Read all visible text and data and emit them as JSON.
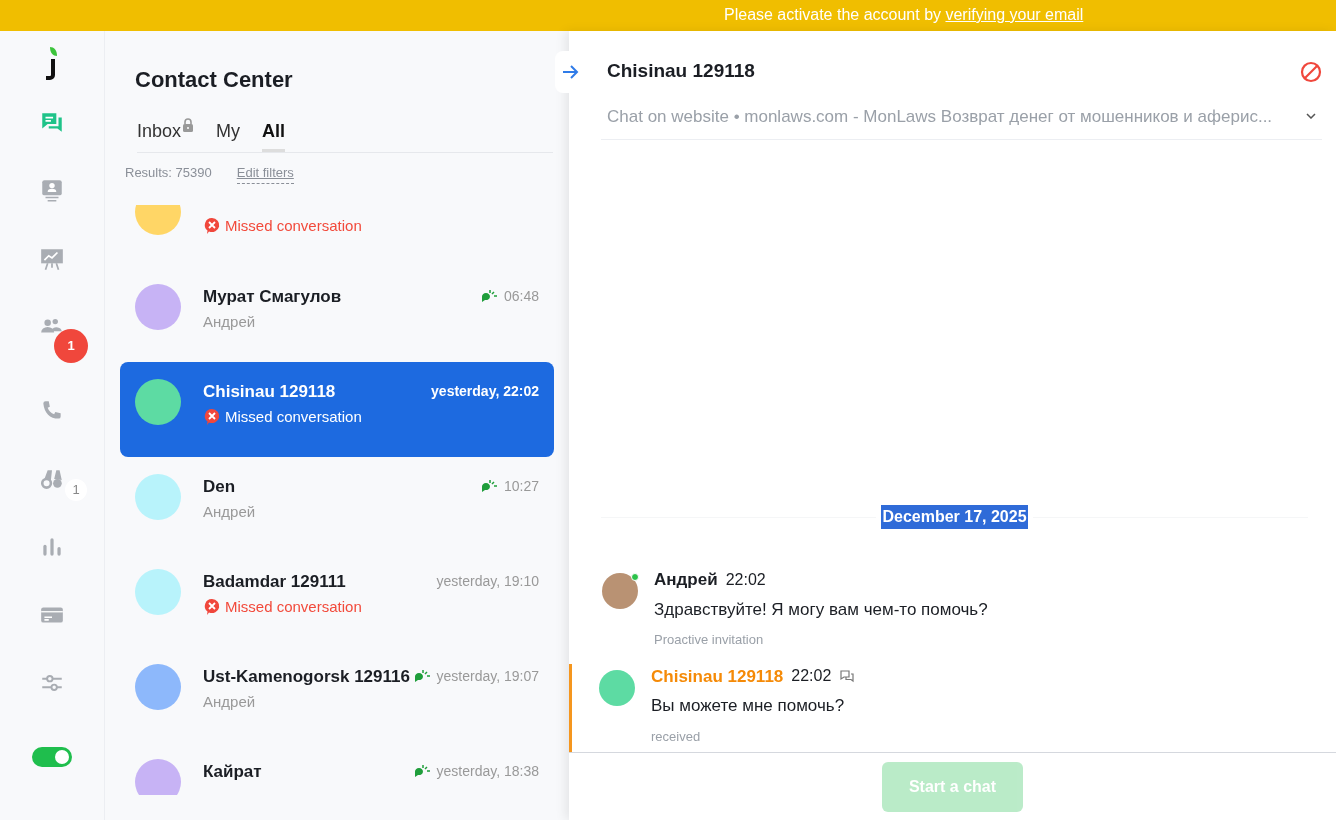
{
  "banner": {
    "text": "Please activate the account by ",
    "link": "verifying your email"
  },
  "sidebar": {
    "items": [
      {
        "kind": "chats",
        "selected": true
      },
      {
        "kind": "contacts",
        "selected": false
      },
      {
        "kind": "reports",
        "selected": false
      },
      {
        "kind": "team",
        "selected": false,
        "badge": "1",
        "badge_alert": true
      },
      {
        "kind": "phone",
        "selected": false
      },
      {
        "kind": "binoculars",
        "selected": false,
        "badge": "1",
        "badge_alert": false
      },
      {
        "kind": "stats",
        "selected": false
      },
      {
        "kind": "billing",
        "selected": false
      },
      {
        "kind": "settings",
        "selected": false
      }
    ],
    "status_toggle": {
      "on": true
    }
  },
  "list": {
    "title": "Contact Center",
    "tabs": [
      {
        "label": "Inbox",
        "locked": true,
        "selected": false
      },
      {
        "label": "My",
        "locked": false,
        "selected": false
      },
      {
        "label": "All",
        "locked": false,
        "selected": true
      }
    ],
    "results": "Results: 75390",
    "edit_filters": "Edit filters",
    "conversations": [
      {
        "kind": "missed",
        "subtitle": "Missed conversation",
        "color": "#ffd666",
        "selected": false
      },
      {
        "name": "Мурат Смагулов",
        "time": "06:48",
        "kind": "agent",
        "subtitle": "Андрей",
        "color": "#c7b3f5",
        "selected": false
      },
      {
        "name": "Chisinau 129118",
        "time": "yesterday, 22:02",
        "kind": "missed",
        "subtitle": "Missed conversation",
        "color": "#5ddba3",
        "selected": true
      },
      {
        "name": "Den",
        "time": "10:27",
        "kind": "agent",
        "subtitle": "Андрей",
        "color": "#b8f3fb",
        "selected": false
      },
      {
        "name": "Badamdar 129111",
        "time": "yesterday, 19:10",
        "kind": "missed",
        "subtitle": "Missed conversation",
        "color": "#b8f3fb",
        "selected": false
      },
      {
        "name": "Ust-Kamenogorsk 129116",
        "time": "yesterday, 19:07",
        "kind": "agent",
        "subtitle": "Андрей",
        "color": "#8db8fb",
        "selected": false
      },
      {
        "name": "Кайрат",
        "time": "yesterday, 18:38",
        "kind": "agent",
        "color": "#c7b3f5",
        "selected": false
      }
    ]
  },
  "chat": {
    "title": "Chisinau 129118",
    "subtitle": "Chat on website • monlaws.com - MonLaws Возврат денег от мошенников и аферис...",
    "date": "December 17, 2025",
    "messages": [
      {
        "kind": "agent",
        "author": "Андрей",
        "time": "22:02",
        "text": "Здравствуйте! Я могу вам чем-то помочь?",
        "note": "Proactive invitation",
        "online": true
      },
      {
        "kind": "visitor",
        "author": "Chisinau 129118",
        "time": "22:02",
        "text": "Вы можете мне помочь?",
        "note": "received",
        "color": "#5ddba3"
      }
    ],
    "start_button": {
      "label": "Start a chat",
      "disabled": true
    }
  }
}
